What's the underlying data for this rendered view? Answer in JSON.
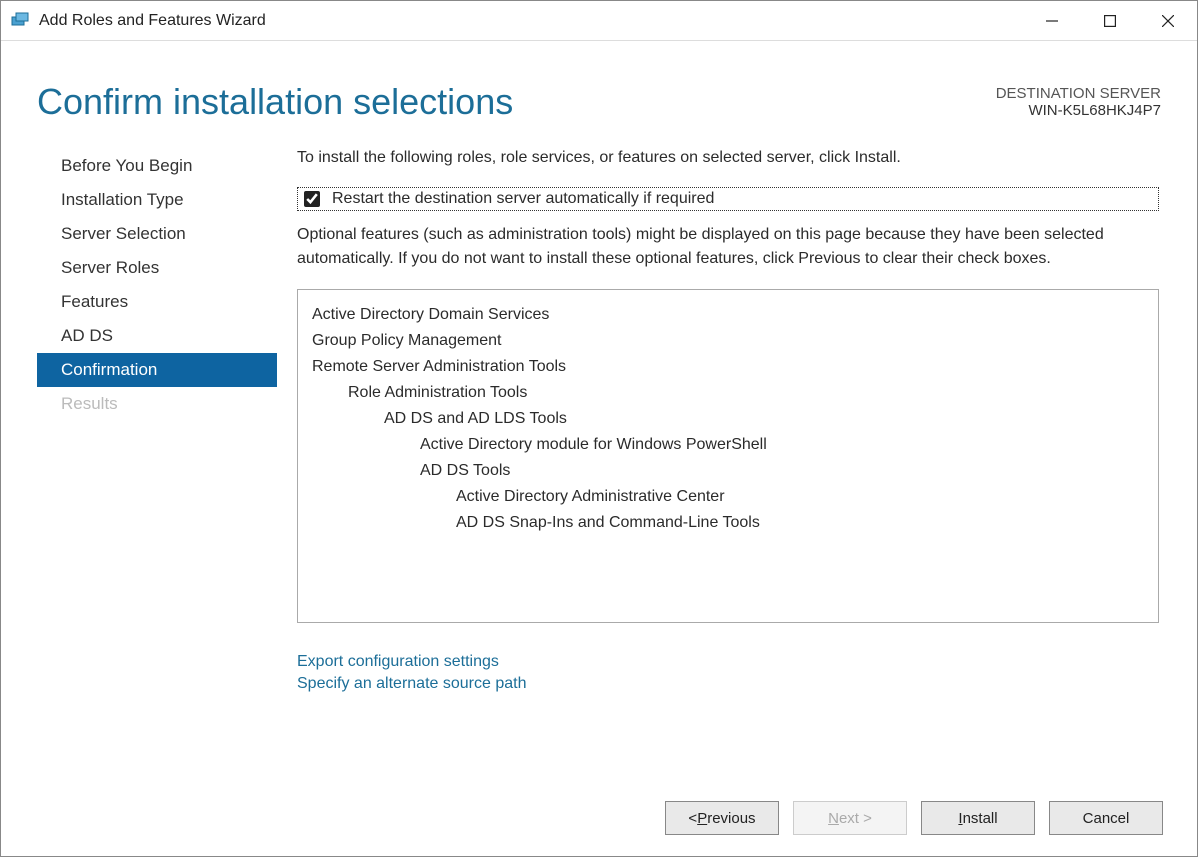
{
  "titlebar": {
    "title": "Add Roles and Features Wizard"
  },
  "header": {
    "title": "Confirm installation selections",
    "server_label": "DESTINATION SERVER",
    "server_name": "WIN-K5L68HKJ4P7"
  },
  "sidebar": {
    "items": [
      {
        "label": "Before You Begin",
        "state": "normal"
      },
      {
        "label": "Installation Type",
        "state": "normal"
      },
      {
        "label": "Server Selection",
        "state": "normal"
      },
      {
        "label": "Server Roles",
        "state": "normal"
      },
      {
        "label": "Features",
        "state": "normal"
      },
      {
        "label": "AD DS",
        "state": "normal"
      },
      {
        "label": "Confirmation",
        "state": "active"
      },
      {
        "label": "Results",
        "state": "disabled"
      }
    ]
  },
  "main": {
    "instruction": "To install the following roles, role services, or features on selected server, click Install.",
    "restart_label": "Restart the destination server automatically if required",
    "restart_checked": true,
    "optional_note": "Optional features (such as administration tools) might be displayed on this page because they have been selected automatically. If you do not want to install these optional features, click Previous to clear their check boxes.",
    "items": [
      {
        "level": 0,
        "text": "Active Directory Domain Services"
      },
      {
        "level": 0,
        "text": "Group Policy Management"
      },
      {
        "level": 0,
        "text": "Remote Server Administration Tools"
      },
      {
        "level": 1,
        "text": "Role Administration Tools"
      },
      {
        "level": 2,
        "text": "AD DS and AD LDS Tools"
      },
      {
        "level": 3,
        "text": "Active Directory module for Windows PowerShell"
      },
      {
        "level": 3,
        "text": "AD DS Tools"
      },
      {
        "level": 4,
        "text": "Active Directory Administrative Center"
      },
      {
        "level": 4,
        "text": "AD DS Snap-Ins and Command-Line Tools"
      }
    ],
    "links": {
      "export": "Export configuration settings",
      "source": "Specify an alternate source path"
    }
  },
  "footer": {
    "previous_prefix": "< ",
    "previous_u": "P",
    "previous_rest": "revious",
    "next_u": "N",
    "next_rest": "ext >",
    "install_u": "I",
    "install_rest": "nstall",
    "cancel": "Cancel"
  }
}
